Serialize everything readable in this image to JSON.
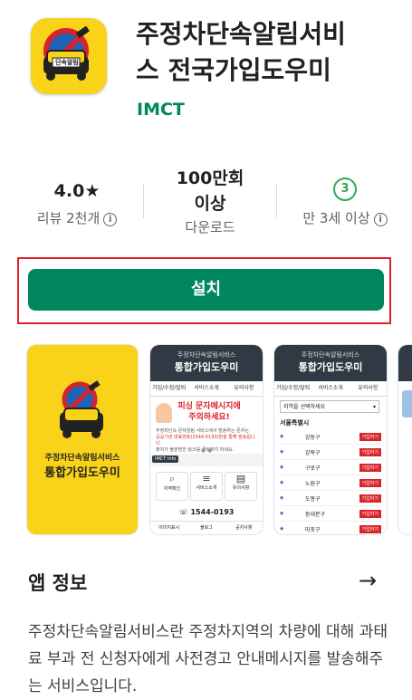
{
  "app": {
    "title_line1": "주정차단속알림서비",
    "title_line2": "스 전국가입도우미",
    "developer": "IMCT",
    "icon_label": "단속알림"
  },
  "stats": {
    "rating_value": "4.0",
    "rating_star": "★",
    "rating_caption": "리뷰 2천개",
    "downloads_line1": "100만회",
    "downloads_line2": "이상",
    "downloads_caption": "다운로드",
    "age_badge": "3",
    "age_caption": "만 3세 이상",
    "info_glyph": "i"
  },
  "install_label": "설치",
  "screenshots": {
    "s1": {
      "line1": "주정차단속알림서비스",
      "line2": "통합가입도우미"
    },
    "s2": {
      "hdr1": "주정차단속알림서비스",
      "hdr2": "통합가입도우미",
      "nav": [
        "가입/수정/탈퇴",
        "서비스소개",
        "유의사항"
      ],
      "headline1": "피싱 문자메시지에",
      "headline2": "주의하세요!",
      "body1": "주정차단속 문자알림 서비스에서 발송하는 문자는",
      "body2": "공공기관 대표번호(1544-0193)만을 통해 발송됩니다.",
      "body3": "출처가 불분명한 링크를 클릭하지 마세요.",
      "imct": "IMCT info",
      "tiles": [
        "지역확인",
        "서비스소개",
        "유의사항"
      ],
      "phone": "1544-0193",
      "footer": [
        "이미지표시",
        "블로그",
        "공지사항"
      ]
    },
    "s3": {
      "hdr1": "주정차단속알림서비스",
      "hdr2": "통합가입도우미",
      "nav": [
        "가입/수정/탈퇴",
        "서비스소개",
        "유의사항"
      ],
      "select": "지역을 선택하세요",
      "region": "서울특별시",
      "districts": [
        "강동구",
        "강북구",
        "구로구",
        "노원구",
        "도봉구",
        "동대문구",
        "마포구"
      ],
      "join": "가입하기"
    }
  },
  "about": {
    "title": "앱 정보",
    "arrow": "→",
    "description": "주정차단속알림서비스란 주정차지역의 차량에 대해 과태료 부과 전 신청자에게 사전경고 안내메시지를 발송해주는 서비스입니다."
  },
  "colors": {
    "accent": "#01875f",
    "highlight_frame": "#e0202a",
    "icon_bg": "#f9d21a"
  }
}
